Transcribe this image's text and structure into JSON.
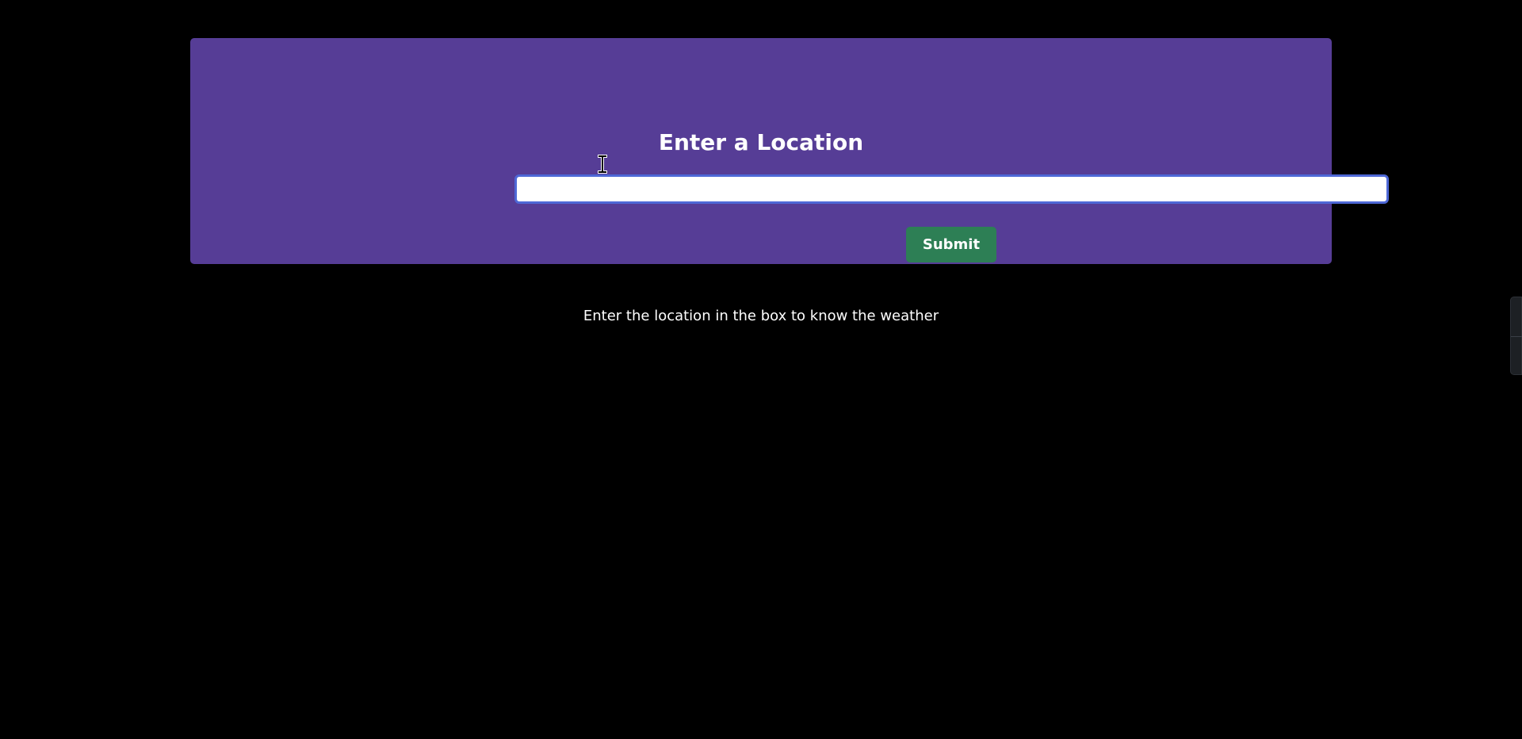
{
  "header": {
    "title": "Enter a Location"
  },
  "search": {
    "value": "",
    "placeholder": ""
  },
  "form": {
    "submit_label": "Submit"
  },
  "main": {
    "helper_text": "Enter the location in the box to know the weather"
  },
  "icons": {
    "cursor": "text-cursor-icon"
  },
  "colors": {
    "background": "#000000",
    "card": "#563d96",
    "input_border": "#4e68d6",
    "submit": "#2d7f55",
    "text": "#ffffff"
  }
}
